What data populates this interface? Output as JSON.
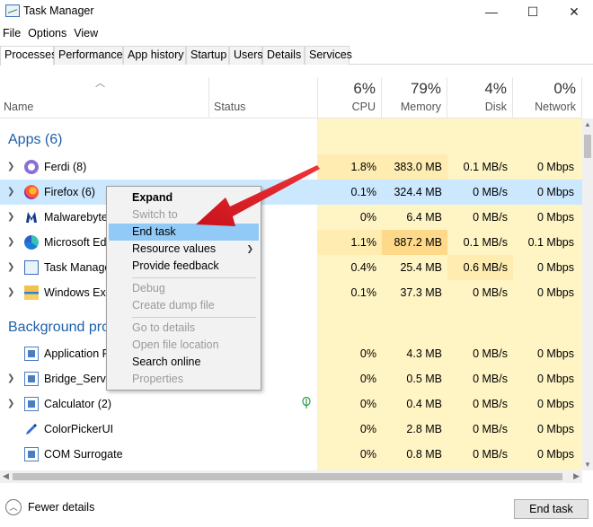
{
  "window": {
    "title": "Task Manager",
    "minimize": "—",
    "maximize": "☐",
    "close": "✕"
  },
  "menu": [
    "File",
    "Options",
    "View"
  ],
  "tabs": [
    "Processes",
    "Performance",
    "App history",
    "Startup",
    "Users",
    "Details",
    "Services"
  ],
  "columns": {
    "name": "Name",
    "status": "Status",
    "cpu": {
      "pct": "6%",
      "label": "CPU"
    },
    "memory": {
      "pct": "79%",
      "label": "Memory"
    },
    "disk": {
      "pct": "4%",
      "label": "Disk"
    },
    "network": {
      "pct": "0%",
      "label": "Network"
    }
  },
  "groups": {
    "apps": "Apps (6)",
    "background": "Background pro"
  },
  "apps": [
    {
      "name": "Ferdi (8)",
      "icon": "ferdi-icon",
      "cpu": "1.8%",
      "memory": "383.0 MB",
      "disk": "0.1 MB/s",
      "network": "0 Mbps"
    },
    {
      "name": "Firefox (6)",
      "icon": "firefox-icon",
      "cpu": "0.1%",
      "memory": "324.4 MB",
      "disk": "0 MB/s",
      "network": "0 Mbps"
    },
    {
      "name": "Malwarebyte",
      "icon": "malwarebytes-icon",
      "cpu": "0%",
      "memory": "6.4 MB",
      "disk": "0 MB/s",
      "network": "0 Mbps"
    },
    {
      "name": "Microsoft Ed",
      "icon": "edge-icon",
      "cpu": "1.1%",
      "memory": "887.2 MB",
      "disk": "0.1 MB/s",
      "network": "0.1 Mbps"
    },
    {
      "name": "Task Manage",
      "icon": "task-manager-icon",
      "cpu": "0.4%",
      "memory": "25.4 MB",
      "disk": "0.6 MB/s",
      "network": "0 Mbps"
    },
    {
      "name": "Windows Exp",
      "icon": "explorer-icon",
      "cpu": "0.1%",
      "memory": "37.3 MB",
      "disk": "0 MB/s",
      "network": "0 Mbps"
    }
  ],
  "background": [
    {
      "name": "Application F",
      "icon": "app-window-icon",
      "cpu": "0%",
      "memory": "4.3 MB",
      "disk": "0 MB/s",
      "network": "0 Mbps"
    },
    {
      "name": "Bridge_Servic",
      "icon": "app-window-icon",
      "cpu": "0%",
      "memory": "0.5 MB",
      "disk": "0 MB/s",
      "network": "0 Mbps"
    },
    {
      "name": "Calculator (2)",
      "icon": "calculator-icon",
      "cpu": "0%",
      "memory": "0.4 MB",
      "disk": "0 MB/s",
      "network": "0 Mbps"
    },
    {
      "name": "ColorPickerUI",
      "icon": "color-picker-icon",
      "cpu": "0%",
      "memory": "2.8 MB",
      "disk": "0 MB/s",
      "network": "0 Mbps"
    },
    {
      "name": "COM Surrogate",
      "icon": "app-window-icon",
      "cpu": "0%",
      "memory": "0.8 MB",
      "disk": "0 MB/s",
      "network": "0 Mbps"
    }
  ],
  "context_menu": {
    "expand": "Expand",
    "switch_to": "Switch to",
    "end_task": "End task",
    "resource_values": "Resource values",
    "provide_feedback": "Provide feedback",
    "debug": "Debug",
    "create_dump": "Create dump file",
    "go_to_details": "Go to details",
    "open_file_location": "Open file location",
    "search_online": "Search online",
    "properties": "Properties"
  },
  "footer": {
    "fewer_details": "Fewer details",
    "end_task": "End task"
  },
  "colors": {
    "accent_group": "#1f5fa8",
    "heat_light": "#fff4c4",
    "heat_high": "#ffd98a",
    "selection": "#cce8ff",
    "arrow": "#e8242a"
  }
}
